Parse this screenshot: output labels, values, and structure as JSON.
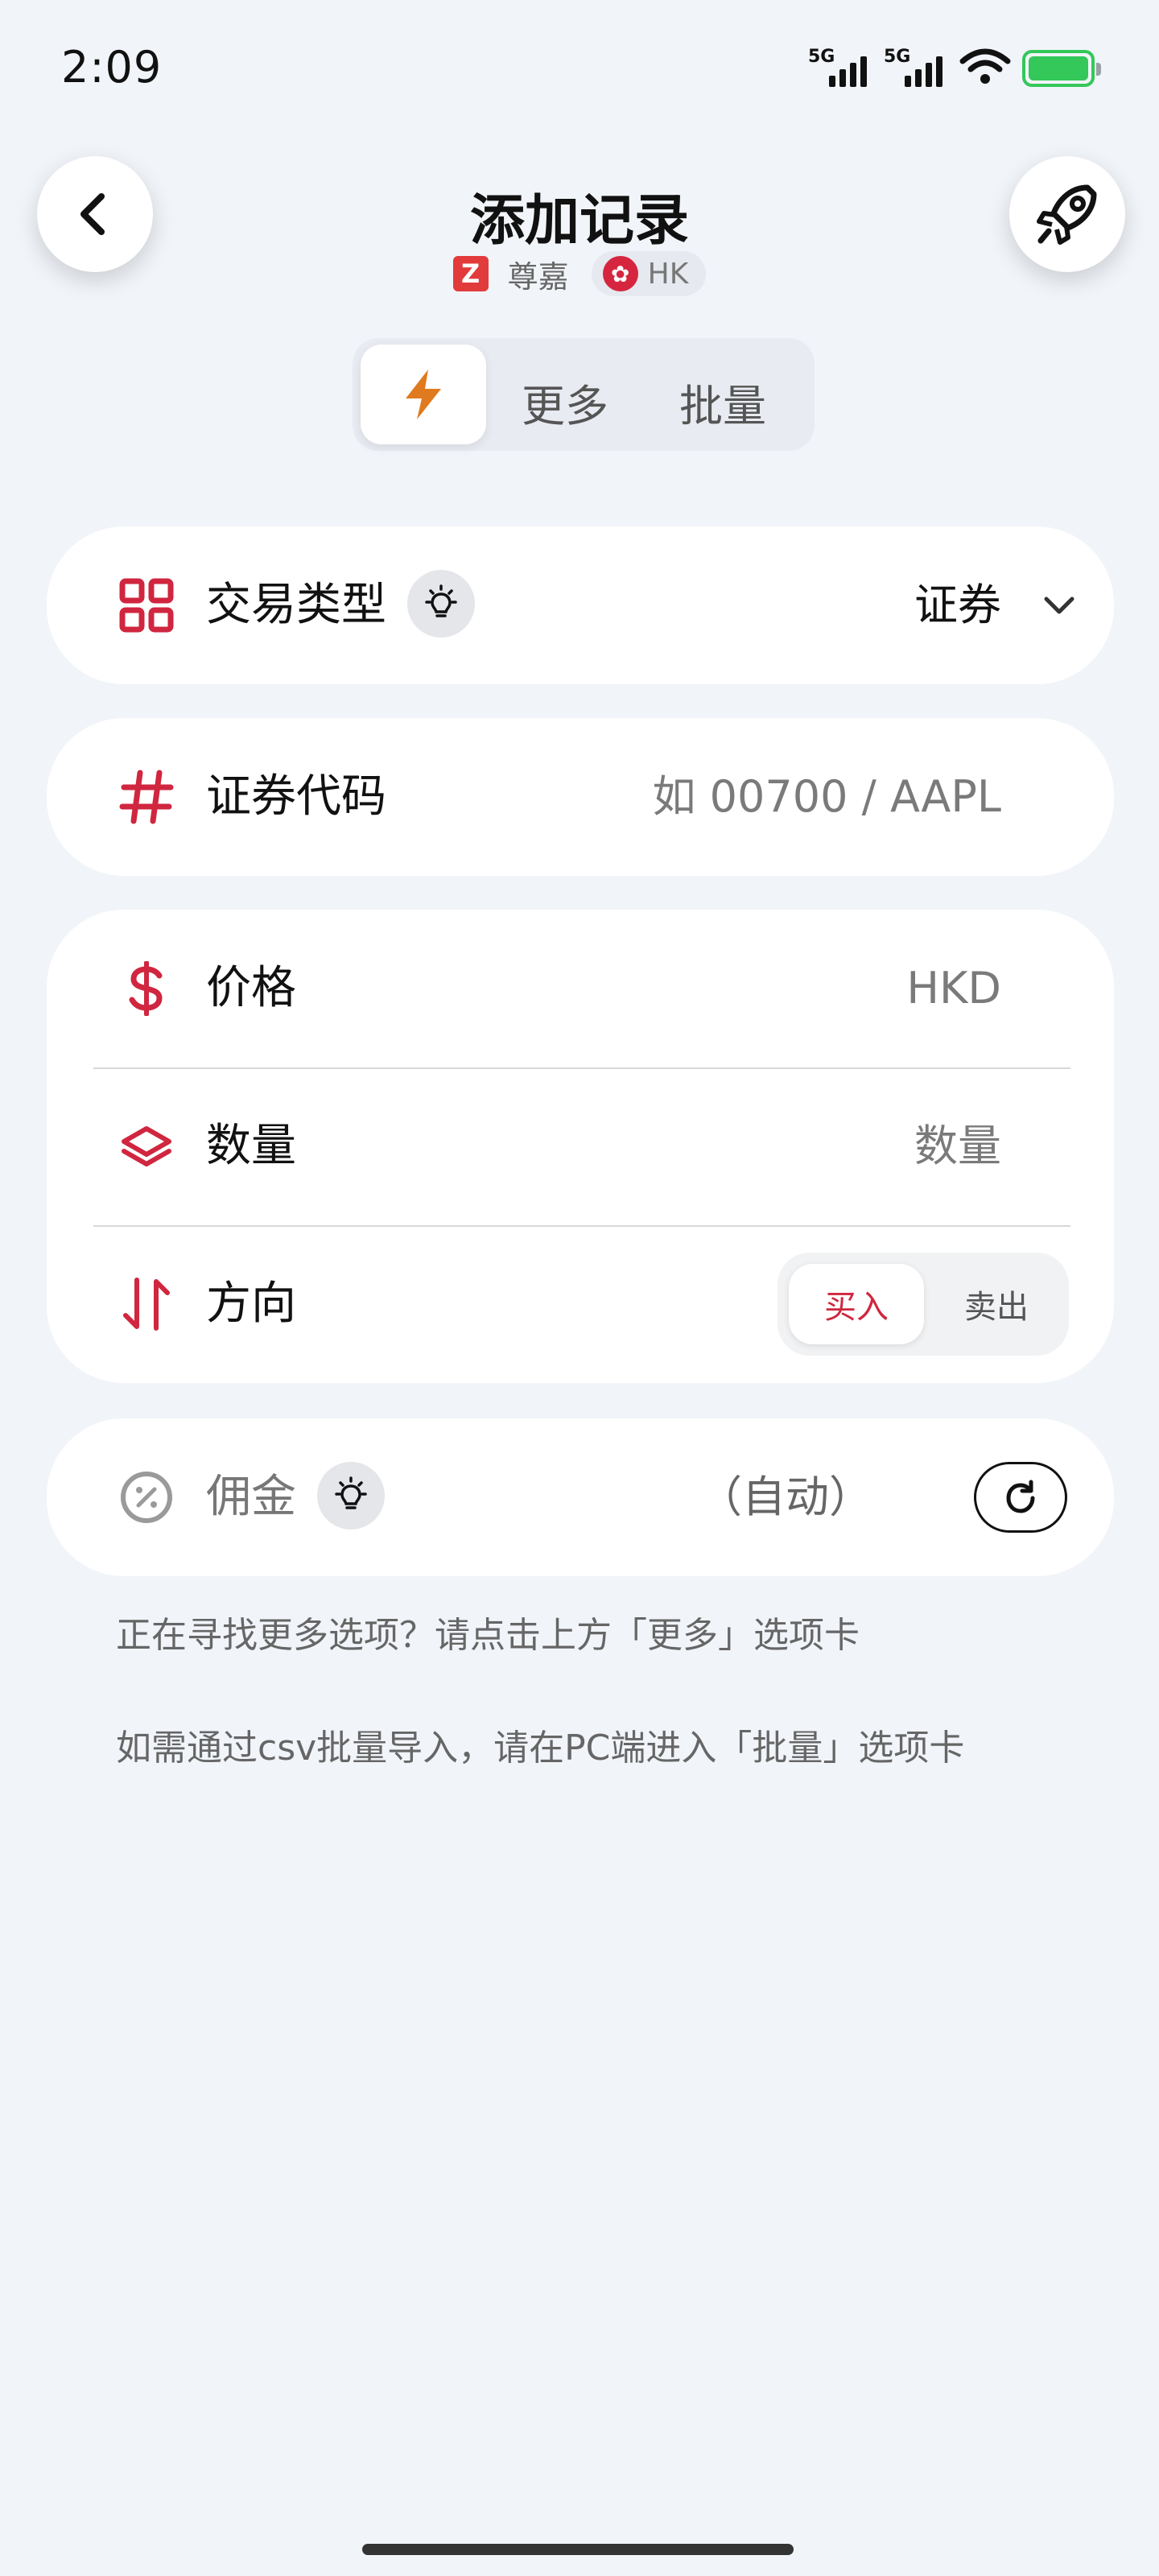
{
  "status_bar": {
    "time": "2:09",
    "signal1_label": "5G",
    "signal2_label": "5G"
  },
  "header": {
    "title": "添加记录",
    "broker_logo_text": "Z",
    "broker_name": "尊嘉",
    "market": "HK",
    "back_icon": "chevron-left-icon",
    "action_icon": "rocket-icon"
  },
  "tabs": {
    "quick_icon": "lightning-icon",
    "more_label": "更多",
    "batch_label": "批量"
  },
  "form": {
    "trade_type": {
      "label": "交易类型",
      "value": "证券",
      "icon": "grid-icon"
    },
    "security_code": {
      "label": "证券代码",
      "placeholder": "如 00700 / AAPL",
      "icon": "hash-icon"
    },
    "price": {
      "label": "价格",
      "placeholder": "HKD",
      "icon": "dollar-icon"
    },
    "quantity": {
      "label": "数量",
      "placeholder": "数量",
      "icon": "layers-icon"
    },
    "direction": {
      "label": "方向",
      "buy_label": "买入",
      "sell_label": "卖出",
      "selected": "买入",
      "icon": "arrows-updown-icon"
    },
    "commission": {
      "label": "佣金",
      "value": "（自动）",
      "icon": "percent-icon"
    }
  },
  "hints": {
    "more_options": "正在寻找更多选项？请点击上方「更多」选项卡",
    "csv_import": "如需通过csv批量导入，请在PC端进入「批量」选项卡"
  },
  "colors": {
    "accent": "#d0263f",
    "tab_icon": "#e07a1f",
    "background": "#f1f4f9",
    "battery": "#34c759"
  }
}
